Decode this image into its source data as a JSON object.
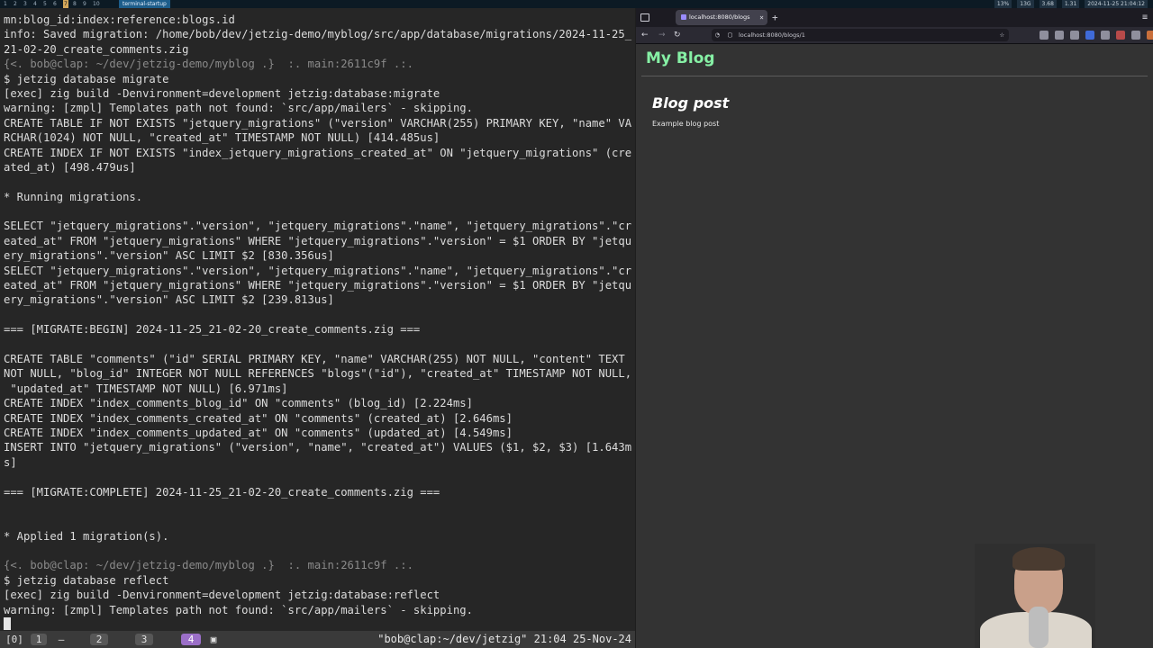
{
  "topbar": {
    "workspaces": [
      "1",
      "2",
      "3",
      "4",
      "5",
      "6",
      "7",
      "8",
      "9",
      "10"
    ],
    "active_workspace": "7",
    "window_title": "terminal-startup",
    "stats": [
      "13%",
      "13G",
      "3.68",
      "1.31",
      "2024-11-25 21:04:12"
    ]
  },
  "terminal": {
    "lines": [
      "mn:blog_id:index:reference:blogs.id",
      "info: Saved migration: /home/bob/dev/jetzig-demo/myblog/src/app/database/migrations/2024-11-25_",
      "21-02-20_create_comments.zig",
      "{<. bob@clap: ~/dev/jetzig-demo/myblog .}  :. main:2611c9f .:.",
      "$ jetzig database migrate",
      "[exec] zig build -Denvironment=development jetzig:database:migrate",
      "warning: [zmpl] Templates path not found: `src/app/mailers` - skipping.",
      "CREATE TABLE IF NOT EXISTS \"jetquery_migrations\" (\"version\" VARCHAR(255) PRIMARY KEY, \"name\" VA",
      "RCHAR(1024) NOT NULL, \"created_at\" TIMESTAMP NOT NULL) [414.485us]",
      "CREATE INDEX IF NOT EXISTS \"index_jetquery_migrations_created_at\" ON \"jetquery_migrations\" (cre",
      "ated_at) [498.479us]",
      "",
      "* Running migrations.",
      "",
      "SELECT \"jetquery_migrations\".\"version\", \"jetquery_migrations\".\"name\", \"jetquery_migrations\".\"cr",
      "eated_at\" FROM \"jetquery_migrations\" WHERE \"jetquery_migrations\".\"version\" = $1 ORDER BY \"jetqu",
      "ery_migrations\".\"version\" ASC LIMIT $2 [830.356us]",
      "SELECT \"jetquery_migrations\".\"version\", \"jetquery_migrations\".\"name\", \"jetquery_migrations\".\"cr",
      "eated_at\" FROM \"jetquery_migrations\" WHERE \"jetquery_migrations\".\"version\" = $1 ORDER BY \"jetqu",
      "ery_migrations\".\"version\" ASC LIMIT $2 [239.813us]",
      "",
      "=== [MIGRATE:BEGIN] 2024-11-25_21-02-20_create_comments.zig ===",
      "",
      "CREATE TABLE \"comments\" (\"id\" SERIAL PRIMARY KEY, \"name\" VARCHAR(255) NOT NULL, \"content\" TEXT",
      "NOT NULL, \"blog_id\" INTEGER NOT NULL REFERENCES \"blogs\"(\"id\"), \"created_at\" TIMESTAMP NOT NULL,",
      " \"updated_at\" TIMESTAMP NOT NULL) [6.971ms]",
      "CREATE INDEX \"index_comments_blog_id\" ON \"comments\" (blog_id) [2.224ms]",
      "CREATE INDEX \"index_comments_created_at\" ON \"comments\" (created_at) [2.646ms]",
      "CREATE INDEX \"index_comments_updated_at\" ON \"comments\" (updated_at) [4.549ms]",
      "INSERT INTO \"jetquery_migrations\" (\"version\", \"name\", \"created_at\") VALUES ($1, $2, $3) [1.643m",
      "s]",
      "",
      "=== [MIGRATE:COMPLETE] 2024-11-25_21-02-20_create_comments.zig ===",
      "",
      "",
      "* Applied 1 migration(s).",
      "",
      "{<. bob@clap: ~/dev/jetzig-demo/myblog .}  :. main:2611c9f .:.",
      "$ jetzig database reflect",
      "[exec] zig build -Denvironment=development jetzig:database:reflect",
      "warning: [zmpl] Templates path not found: `src/app/mailers` - skipping."
    ],
    "prompt_line_indices": [
      3,
      37
    ]
  },
  "tmux": {
    "session": "[0]",
    "windows": [
      "1",
      "—",
      "2",
      "3",
      "4",
      "▣"
    ],
    "active_window": "4",
    "status": "\"bob@clap:~/dev/jetzig\" 21:04 25-Nov-24"
  },
  "browser": {
    "tab_title": "localhost:8080/blogs",
    "tab_close": "×",
    "new_tab": "+",
    "menu": "≡",
    "nav": {
      "back": "←",
      "forward": "→",
      "reload": "↻"
    },
    "url": "localhost:8080/blogs/1",
    "star": "☆",
    "ext_colors": [
      "#8f8f9d",
      "#8f8f9d",
      "#8f8f9d",
      "#3f6ad8",
      "#8f8f9d",
      "#b84a4a",
      "#8f8f9d",
      "#c96f3b"
    ]
  },
  "page": {
    "site_title": "My Blog",
    "post_title": "Blog post",
    "post_body": "Example blog post",
    "accent": "#86f0a5"
  }
}
